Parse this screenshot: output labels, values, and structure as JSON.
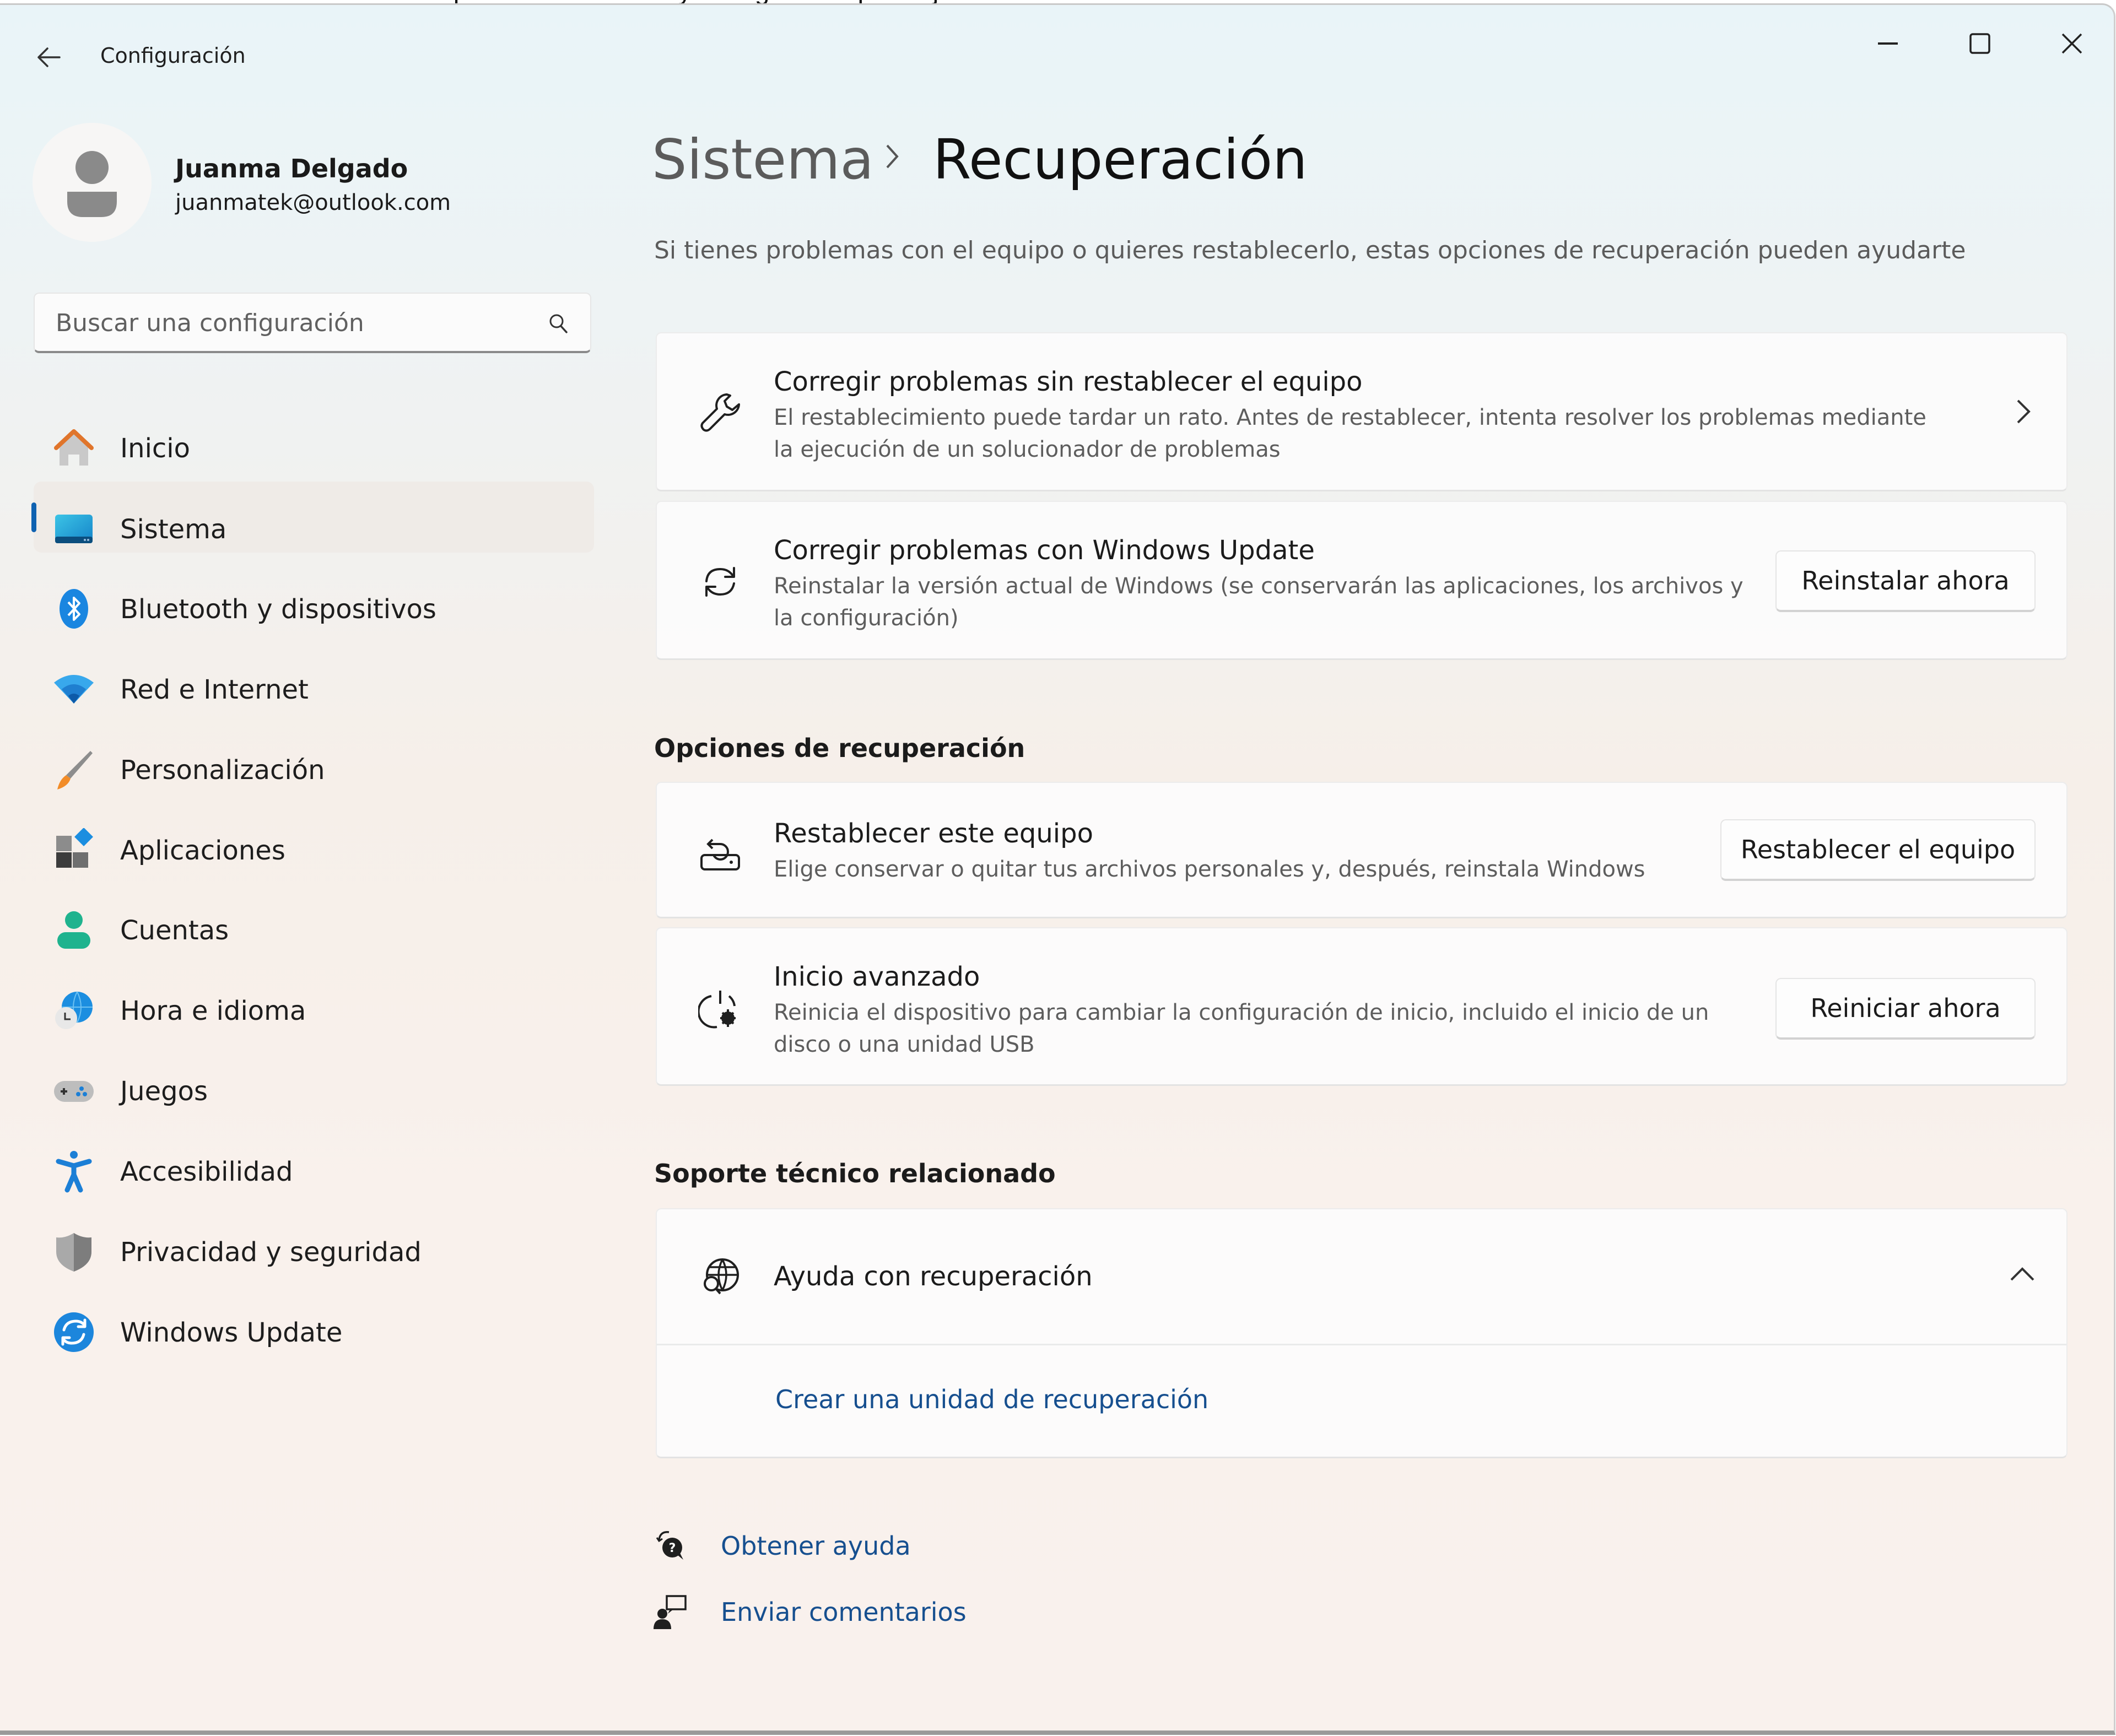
{
  "background_document": {
    "clipped_text": "de que estén iniciados y configurados para ejecutarse automáticamente"
  },
  "window": {
    "title": "Configuración",
    "controls": {
      "minimize": "minimize-icon",
      "maximize": "maximize-icon",
      "close": "close-icon"
    }
  },
  "profile": {
    "name": "Juanma Delgado",
    "email": "juanmatek@outlook.com"
  },
  "search": {
    "placeholder": "Buscar una configuración",
    "value": ""
  },
  "sidebar": {
    "selected_index": 1,
    "accent": "#0f62b1",
    "items": [
      {
        "label": "Inicio",
        "icon": "home-icon"
      },
      {
        "label": "Sistema",
        "icon": "system-icon"
      },
      {
        "label": "Bluetooth y dispositivos",
        "icon": "bluetooth-icon"
      },
      {
        "label": "Red e Internet",
        "icon": "wifi-icon"
      },
      {
        "label": "Personalización",
        "icon": "brush-icon"
      },
      {
        "label": "Aplicaciones",
        "icon": "apps-icon"
      },
      {
        "label": "Cuentas",
        "icon": "account-icon"
      },
      {
        "label": "Hora e idioma",
        "icon": "time-language-icon"
      },
      {
        "label": "Juegos",
        "icon": "gamepad-icon"
      },
      {
        "label": "Accesibilidad",
        "icon": "accessibility-icon"
      },
      {
        "label": "Privacidad y seguridad",
        "icon": "shield-icon"
      },
      {
        "label": "Windows Update",
        "icon": "windows-update-icon"
      }
    ]
  },
  "main": {
    "breadcrumb": {
      "parent": "Sistema",
      "current": "Recuperación"
    },
    "subtitle": "Si tienes problemas con el equipo o quieres restablecerlo, estas opciones de recuperación pueden ayudarte",
    "cards": [
      {
        "title": "Corregir problemas sin restablecer el equipo",
        "description": "El restablecimiento puede tardar un rato. Antes de restablecer, intenta resolver los problemas mediante la ejecución de un solucionador de problemas",
        "icon": "wrench-icon",
        "action": "chevron-right-icon"
      },
      {
        "title": "Corregir problemas con Windows Update",
        "description": "Reinstalar la versión actual de Windows (se conservarán las aplicaciones, los archivos y la configuración)",
        "icon": "sync-icon",
        "button": "Reinstalar ahora"
      }
    ],
    "recovery_options": {
      "heading": "Opciones de recuperación",
      "items": [
        {
          "title": "Restablecer este equipo",
          "description": "Elige conservar o quitar tus archivos personales y, después, reinstala Windows",
          "icon": "reset-pc-icon",
          "button": "Restablecer el equipo"
        },
        {
          "title": "Inicio avanzado",
          "description": "Reinicia el dispositivo para cambiar la configuración de inicio, incluido el inicio de un disco o una unidad USB",
          "icon": "advanced-startup-icon",
          "button": "Reiniciar ahora"
        }
      ]
    },
    "related_support": {
      "heading": "Soporte técnico relacionado",
      "expander": {
        "title": "Ayuda con recuperación",
        "icon": "globe-search-icon",
        "expanded": true,
        "link": "Crear una unidad de recuperación"
      }
    },
    "footer_links": [
      {
        "label": "Obtener ayuda",
        "icon": "get-help-icon"
      },
      {
        "label": "Enviar comentarios",
        "icon": "feedback-icon"
      }
    ],
    "link_color": "#164f8f"
  }
}
